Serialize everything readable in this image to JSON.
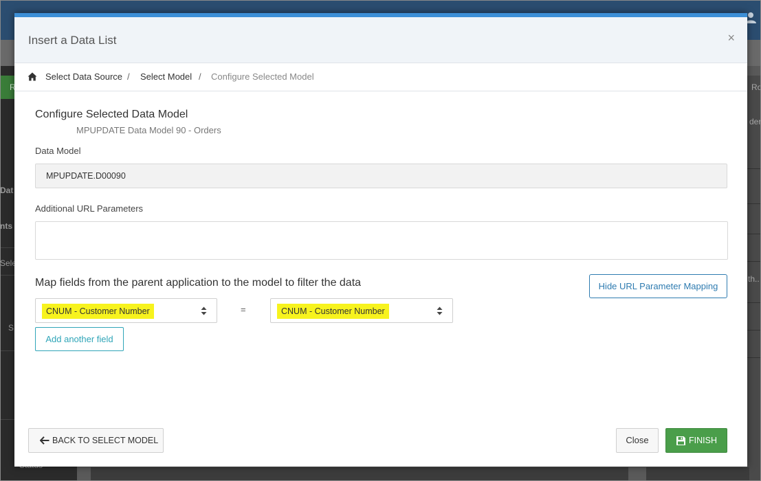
{
  "background": {
    "sidebar_items": [
      "Dat",
      "nts",
      "Sele",
      "S",
      "Status"
    ],
    "right_texts": [
      "Ro",
      "der",
      "th.."
    ],
    "green_button": "R"
  },
  "modal": {
    "title": "Insert a Data List",
    "close_glyph": "×",
    "breadcrumb": {
      "items": [
        "Select Data Source",
        "Select Model",
        "Configure Selected Model"
      ],
      "separator": "/"
    },
    "section_title": "Configure Selected Data Model",
    "section_subtitle": "MPUPDATE Data Model 90 - Orders",
    "data_model": {
      "label": "Data Model",
      "value": "MPUPDATE.D00090"
    },
    "url_params": {
      "label": "Additional URL Parameters",
      "value": ""
    },
    "mapping": {
      "title": "Map fields from the parent application to the model to filter the data",
      "hide_button": "Hide URL Parameter Mapping",
      "left_field": "CNUM - Customer Number",
      "right_field": "CNUM - Customer Number",
      "equals": "=",
      "add_button": "Add another field"
    },
    "footer": {
      "back_button": "BACK TO SELECT MODEL",
      "close_button": "Close",
      "finish_button": "FINISH"
    }
  },
  "colors": {
    "accent": "#3d8fd6",
    "highlight": "#f7f31e",
    "finish": "#4a9e4a",
    "outline_blue": "#2e7bb0",
    "outline_teal": "#2fa5b8"
  }
}
